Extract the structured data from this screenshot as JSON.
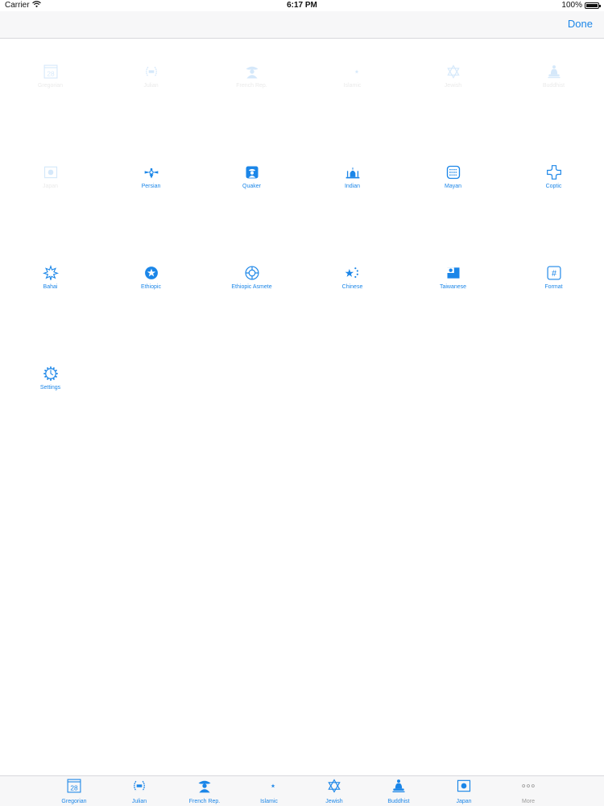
{
  "status_bar": {
    "carrier": "Carrier",
    "time": "6:17 PM",
    "battery": "100%",
    "battery_fill": 1.0
  },
  "nav": {
    "done_label": "Done"
  },
  "calendar_number": "28",
  "grid_items": [
    {
      "label": "Gregorian",
      "icon": "calendar-icon",
      "disabled": true
    },
    {
      "label": "Julian",
      "icon": "laurel-wreath-icon",
      "disabled": true
    },
    {
      "label": "French Rep.",
      "icon": "napoleon-icon",
      "disabled": true
    },
    {
      "label": "Islamic",
      "icon": "crescent-star-icon",
      "disabled": true
    },
    {
      "label": "Jewish",
      "icon": "star-of-david-icon",
      "disabled": true
    },
    {
      "label": "Buddhist",
      "icon": "buddha-icon",
      "disabled": true
    },
    {
      "label": "Japan",
      "icon": "rising-sun-flag-icon",
      "disabled": true
    },
    {
      "label": "Persian",
      "icon": "faravahar-icon",
      "disabled": false
    },
    {
      "label": "Quaker",
      "icon": "quaker-icon",
      "disabled": false
    },
    {
      "label": "Indian",
      "icon": "taj-mahal-icon",
      "disabled": false
    },
    {
      "label": "Mayan",
      "icon": "mayan-glyph-icon",
      "disabled": false
    },
    {
      "label": "Coptic",
      "icon": "coptic-cross-icon",
      "disabled": false
    },
    {
      "label": "Bahai",
      "icon": "nine-pointed-star-icon",
      "disabled": false
    },
    {
      "label": "Ethiopic",
      "icon": "ethiopic-emblem-icon",
      "disabled": false
    },
    {
      "label": "Ethiopic Asmete",
      "icon": "ethiopic-asmete-icon",
      "disabled": false
    },
    {
      "label": "Chinese",
      "icon": "chinese-stars-icon",
      "disabled": false
    },
    {
      "label": "Taiwanese",
      "icon": "taiwan-flag-icon",
      "disabled": false
    },
    {
      "label": "Format",
      "icon": "hash-icon",
      "disabled": false
    },
    {
      "label": "Settings",
      "icon": "gear-icon",
      "disabled": false
    }
  ],
  "tab_items": [
    {
      "label": "Gregorian",
      "icon": "calendar-icon"
    },
    {
      "label": "Julian",
      "icon": "laurel-wreath-icon"
    },
    {
      "label": "French Rep.",
      "icon": "napoleon-icon"
    },
    {
      "label": "Islamic",
      "icon": "crescent-star-icon"
    },
    {
      "label": "Jewish",
      "icon": "star-of-david-icon"
    },
    {
      "label": "Buddhist",
      "icon": "buddha-icon"
    },
    {
      "label": "Japan",
      "icon": "rising-sun-flag-icon"
    },
    {
      "label": "More",
      "icon": "more-dots-icon"
    }
  ],
  "colors": {
    "accent": "#1b86e8",
    "bar_background": "#f7f7f8",
    "disabled": "#888888",
    "more_gray": "#9a9a9a"
  }
}
